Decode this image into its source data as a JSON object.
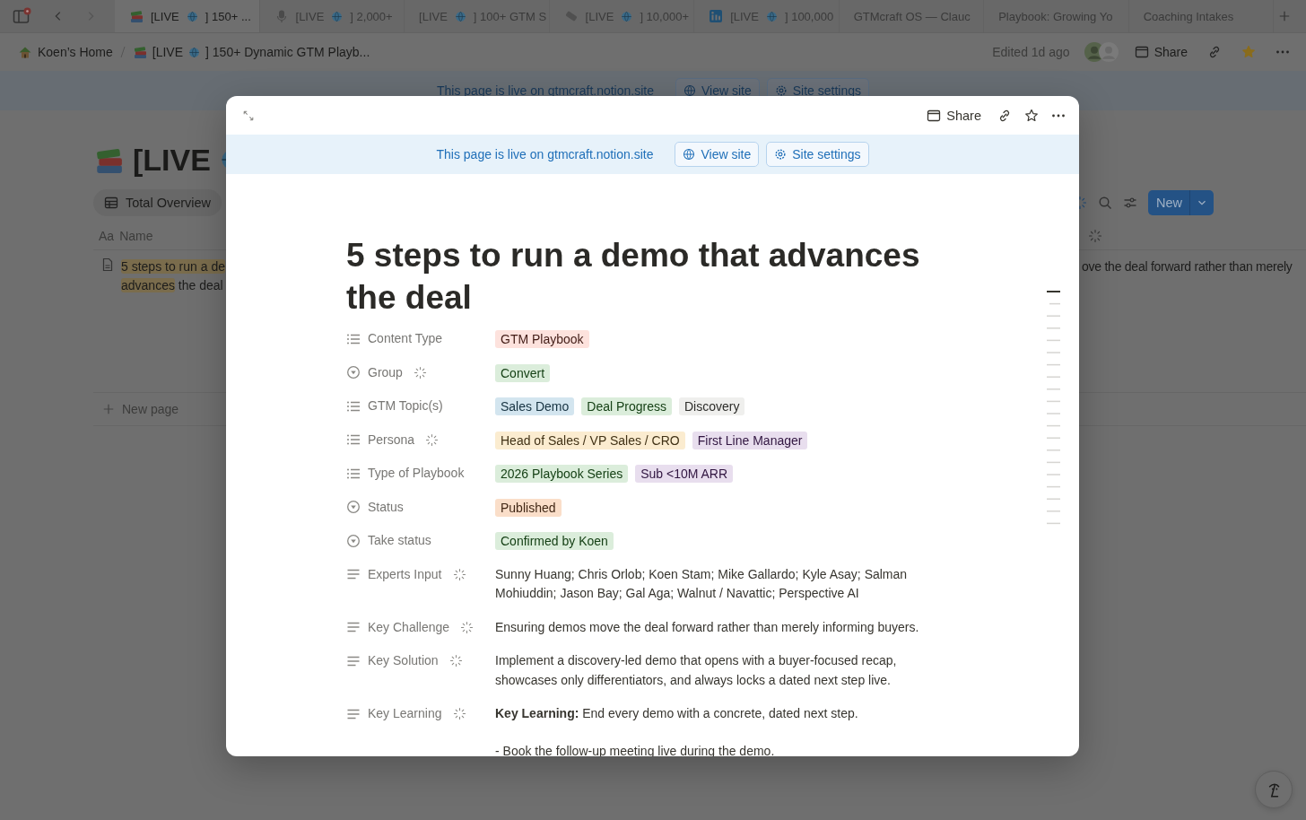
{
  "browser_tabs": [
    {
      "kind": "books",
      "label": "[LIVE",
      "label_after": "] 150+ ...",
      "selected": true
    },
    {
      "kind": "microphone",
      "label": "[LIVE",
      "label_after": "] 2,000+",
      "selected": false
    },
    {
      "kind": "plain",
      "label": "[LIVE",
      "label_after": "] 100+ GTM S",
      "selected": false
    },
    {
      "kind": "scroll",
      "label": "[LIVE",
      "label_after": "] 10,000+",
      "selected": false
    },
    {
      "kind": "linkedin",
      "label": "[LIVE",
      "label_after": "] 100,000",
      "selected": false
    },
    {
      "kind": "plain",
      "label": "GTMcraft OS — Clauc",
      "selected": false
    },
    {
      "kind": "plain",
      "label": "Playbook: Growing Yo",
      "selected": false
    },
    {
      "kind": "plain",
      "label": "Coaching Intakes",
      "selected": false
    }
  ],
  "breadcrumbs": [
    {
      "kind": "house",
      "label": "Koen’s Home"
    },
    {
      "kind": "books",
      "label": "[LIVE",
      "label_after": "] 150+ Dynamic GTM Playb..."
    }
  ],
  "page_header": {
    "edited": "Edited 1d ago",
    "share": "Share",
    "favorite": true
  },
  "site_banner": {
    "text": "This page is live on gtmcraft.notion.site",
    "view_site": "View site",
    "site_settings": "Site settings"
  },
  "database": {
    "title": "[LIVE",
    "view_tab": "Total Overview",
    "new_button": "New",
    "name_column_icon": "Aa",
    "name_column": "Name",
    "rows": [
      {
        "name_lines": [
          [
            {
              "text": "5 steps to run a de",
              "highlighted": true
            }
          ],
          [
            {
              "text": "advances",
              "highlighted": true
            },
            {
              "text": " the deal",
              "highlighted": false
            }
          ]
        ],
        "column_2": "ove the deal forward rather than merely"
      }
    ],
    "new_page": "New page"
  },
  "modal": {
    "share": "Share",
    "favorite": false,
    "site_banner": {
      "text": "This page is live on gtmcraft.notion.site",
      "view_site": "View site",
      "site_settings": "Site settings"
    },
    "title": "5 steps to run a demo that advances the deal",
    "properties": [
      {
        "kind": "multi_select",
        "name": "Content Type",
        "ai": false,
        "tags": [
          {
            "label": "GTM Playbook",
            "color": "#fde2dd"
          }
        ]
      },
      {
        "kind": "select",
        "name": "Group",
        "ai": true,
        "tags": [
          {
            "label": "Convert",
            "color": "#dbeddb"
          }
        ]
      },
      {
        "kind": "multi_select",
        "name": "GTM Topic(s)",
        "ai": false,
        "tags": [
          {
            "label": "Sales Demo",
            "color": "#d3e5ef"
          },
          {
            "label": "Deal Progress",
            "color": "#dbeddb"
          },
          {
            "label": "Discovery",
            "color": "#efefed"
          }
        ]
      },
      {
        "kind": "multi_select",
        "name": "Persona",
        "ai": true,
        "tags": [
          {
            "label": "Head of Sales / VP Sales / CRO",
            "color": "#fbecd0"
          },
          {
            "label": "First Line Manager",
            "color": "#e8deee"
          }
        ]
      },
      {
        "kind": "multi_select",
        "name": "Type of Playbook",
        "ai": false,
        "tags": [
          {
            "label": "2026 Playbook Series",
            "color": "#dbeddb"
          },
          {
            "label": "Sub <10M ARR",
            "color": "#e8deee"
          }
        ]
      },
      {
        "kind": "select",
        "name": "Status",
        "ai": false,
        "tags": [
          {
            "label": "Published",
            "color": "#fadec9"
          }
        ]
      },
      {
        "kind": "select",
        "name": "Take status",
        "ai": false,
        "tags": [
          {
            "label": "Confirmed by Koen",
            "color": "#dbeddb"
          }
        ]
      },
      {
        "kind": "text",
        "name": "Experts Input",
        "ai": true,
        "paragraphs": [
          "Sunny Huang; Chris Orlob; Koen Stam; Mike Gallardo; Kyle Asay; Salman Mohiuddin; Jason Bay; Gal Aga; Walnut / Navattic; Perspective AI"
        ]
      },
      {
        "kind": "text",
        "name": "Key Challenge",
        "ai": true,
        "paragraphs": [
          "Ensuring demos move the deal forward rather than merely informing buyers."
        ]
      },
      {
        "kind": "text",
        "name": "Key Solution",
        "ai": true,
        "paragraphs": [
          "Implement a discovery-led demo that opens with a buyer-focused recap, showcases only differentiators, and always locks a dated next step live."
        ]
      },
      {
        "kind": "text",
        "name": "Key Learning",
        "ai": true,
        "paragraphs": [
          "**Key Learning:** End every demo with a concrete, dated next step.",
          "- Book the follow-up meeting live during the demo."
        ]
      }
    ]
  }
}
